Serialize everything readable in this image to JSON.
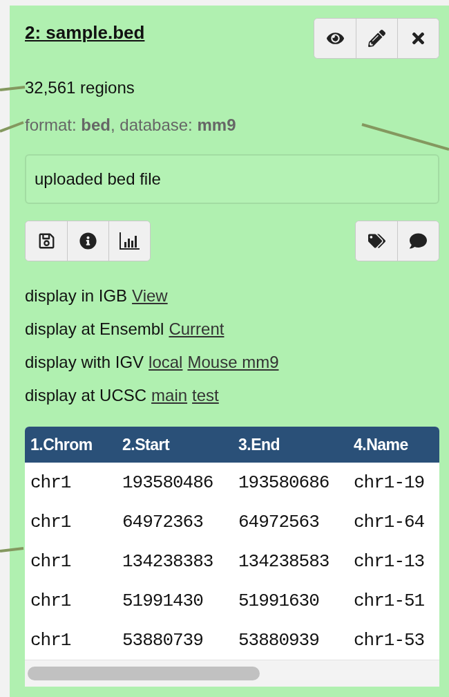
{
  "dataset": {
    "title": "2: sample.bed",
    "summary": "32,561 regions",
    "meta": "format: **bed**, database: **mm9**",
    "annotation": "uploaded bed file",
    "display_links": [
      {
        "label": "display in IGB",
        "links": [
          "View"
        ]
      },
      {
        "label": "display at Ensembl",
        "links": [
          "Current"
        ]
      },
      {
        "label": "display with IGV",
        "links": [
          "local",
          "Mouse mm9"
        ]
      },
      {
        "label": "display at UCSC",
        "links": [
          "main",
          "test"
        ]
      }
    ],
    "table": {
      "columns": [
        "1.Chrom",
        "2.Start",
        "3.End",
        "4.Name"
      ],
      "rows": [
        [
          "chr1",
          "193580486",
          "193580686",
          "chr1-19"
        ],
        [
          "chr1",
          "64972363",
          "64972563",
          "chr1-64"
        ],
        [
          "chr1",
          "134238383",
          "134238583",
          "chr1-13"
        ],
        [
          "chr1",
          "51991430",
          "51991630",
          "chr1-51"
        ],
        [
          "chr1",
          "53880739",
          "53880939",
          "chr1-53"
        ]
      ]
    }
  }
}
